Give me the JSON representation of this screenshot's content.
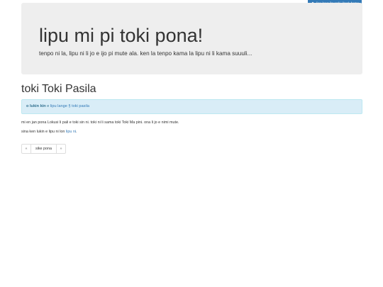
{
  "nav": {
    "home_label": "lipu lawa lipu toki / back home"
  },
  "jumbotron": {
    "title": "lipu mi pi toki pona!",
    "subtitle": "tenpo ni la, lipu ni li jo e ijo pi mute ala. ken la tenpo kama la lipu ni li kama suuuli..."
  },
  "page": {
    "heading": "toki Toki Pasila"
  },
  "alert": {
    "bold": "o lukin kin",
    "mid": " e ",
    "link": "lipu lange § toki pasila"
  },
  "body": {
    "line1": "mi en jan pona Lokusi li pali e toki sin ni. toki ni li sama toki Toki Ma pini. ona li jo e nimi mute.",
    "line2_prefix": "sina ken lukin e lipu ni lon ",
    "line2_link": "lipu ni",
    "line2_suffix": "."
  },
  "pager": {
    "prev": "«",
    "middle": "sike pona",
    "next": "»"
  },
  "colors": {
    "link": "#337ab7",
    "jumbotron_bg": "#eeeeee",
    "alert_bg": "#d9edf7"
  }
}
